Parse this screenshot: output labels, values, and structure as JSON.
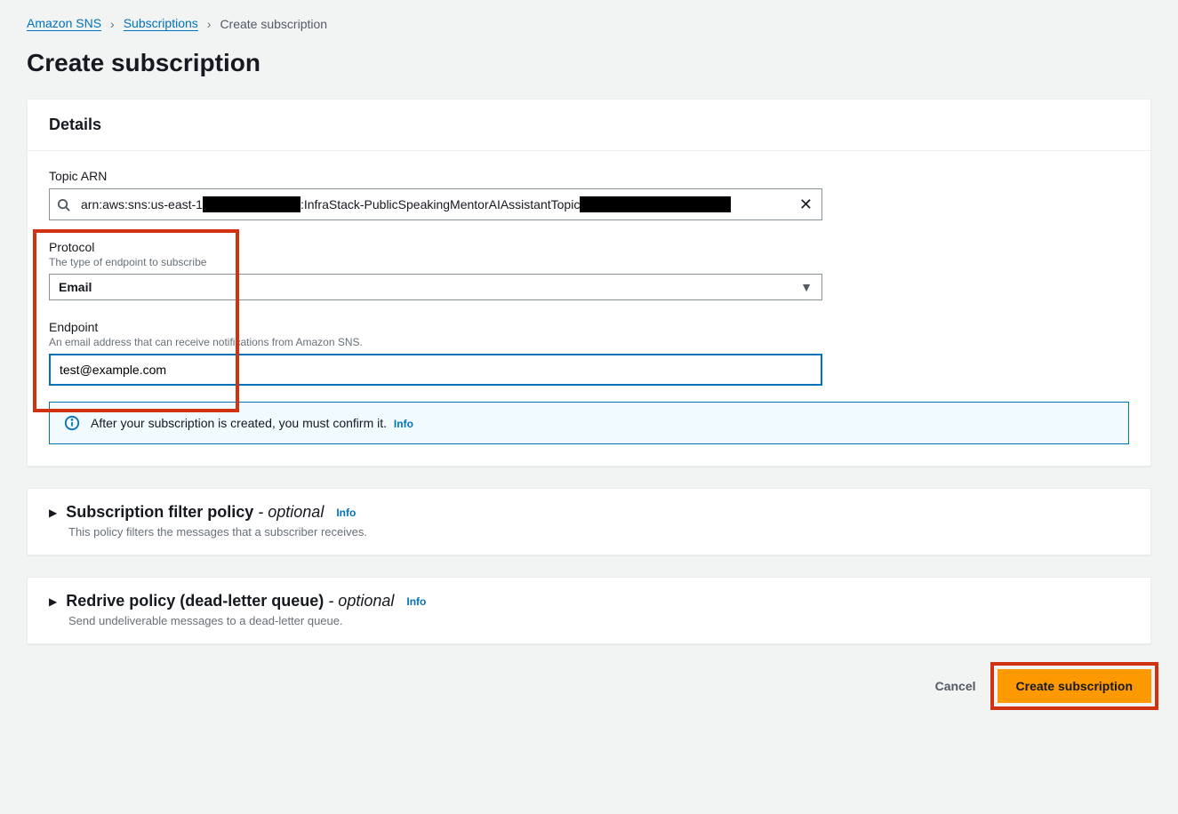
{
  "breadcrumb": {
    "root": "Amazon SNS",
    "mid": "Subscriptions",
    "current": "Create subscription"
  },
  "page": {
    "title": "Create subscription"
  },
  "details": {
    "heading": "Details",
    "topic_arn": {
      "label": "Topic ARN",
      "value_prefix": "arn:aws:sns:us-east-1",
      "value_mid": ":InfraStack-PublicSpeakingMentorAIAssistantTopic"
    },
    "protocol": {
      "label": "Protocol",
      "desc": "The type of endpoint to subscribe",
      "value": "Email"
    },
    "endpoint": {
      "label": "Endpoint",
      "desc": "An email address that can receive notifications from Amazon SNS.",
      "value": "test@example.com"
    },
    "confirm_banner": {
      "text": "After your subscription is created, you must confirm it.",
      "info": "Info"
    }
  },
  "filter_policy": {
    "title": "Subscription filter policy",
    "optional_suffix": " - optional",
    "info": "Info",
    "desc": "This policy filters the messages that a subscriber receives."
  },
  "redrive_policy": {
    "title": "Redrive policy (dead-letter queue)",
    "optional_suffix": " - optional",
    "info": "Info",
    "desc": "Send undeliverable messages to a dead-letter queue."
  },
  "actions": {
    "cancel": "Cancel",
    "create": "Create subscription"
  }
}
